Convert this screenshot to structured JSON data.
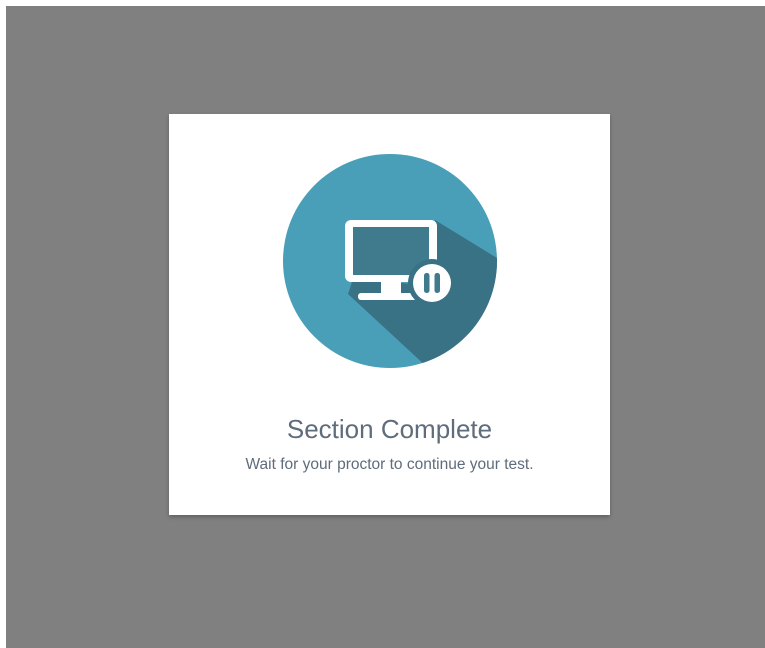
{
  "dialog": {
    "title": "Section Complete",
    "message": "Wait for your proctor to continue your test.",
    "icon": "monitor-paused-icon"
  },
  "colors": {
    "overlay": "#808080",
    "circle": "#4a9fb8",
    "shadow": "#3a7285",
    "screen_fill": "#3f7a8d",
    "text": "#5f6c7b"
  }
}
